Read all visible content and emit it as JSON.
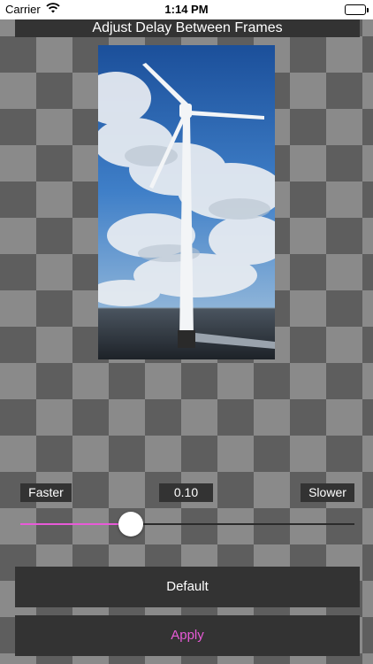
{
  "status_bar": {
    "carrier": "Carrier",
    "time": "1:14 PM"
  },
  "header": {
    "title": "Adjust Delay Between Frames"
  },
  "controls": {
    "faster_label": "Faster",
    "slower_label": "Slower",
    "value_text": "0.10",
    "slider_fraction": 0.33,
    "accent_color": "#e85ad8"
  },
  "buttons": {
    "default_label": "Default",
    "apply_label": "Apply"
  }
}
